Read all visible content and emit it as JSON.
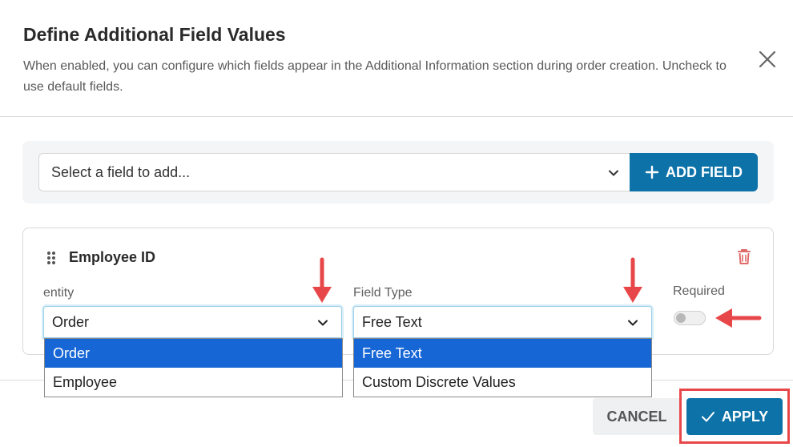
{
  "dialog": {
    "title": "Define Additional Field Values",
    "description": "When enabled, you can configure which fields appear in the Additional Information section during order creation. Uncheck to use default fields.",
    "close_icon": "close-icon"
  },
  "add_field": {
    "placeholder": "Select a field to add...",
    "button_label": "ADD FIELD",
    "button_icon": "plus-icon"
  },
  "field_card": {
    "title": "Employee ID",
    "drag_icon": "drag-handle-icon",
    "delete_icon": "trash-icon",
    "entity": {
      "label": "entity",
      "value": "Order",
      "options": [
        "Order",
        "Employee"
      ]
    },
    "field_type": {
      "label": "Field Type",
      "value": "Free Text",
      "options": [
        "Free Text",
        "Custom Discrete Values"
      ]
    },
    "required": {
      "label": "Required",
      "enabled": false
    }
  },
  "footer": {
    "cancel_label": "CANCEL",
    "apply_label": "APPLY",
    "apply_icon": "check-icon"
  },
  "colors": {
    "primary": "#0d72a8",
    "option_selected": "#1766d6",
    "annotation": "#e8474a",
    "delete": "#e06b6b"
  }
}
